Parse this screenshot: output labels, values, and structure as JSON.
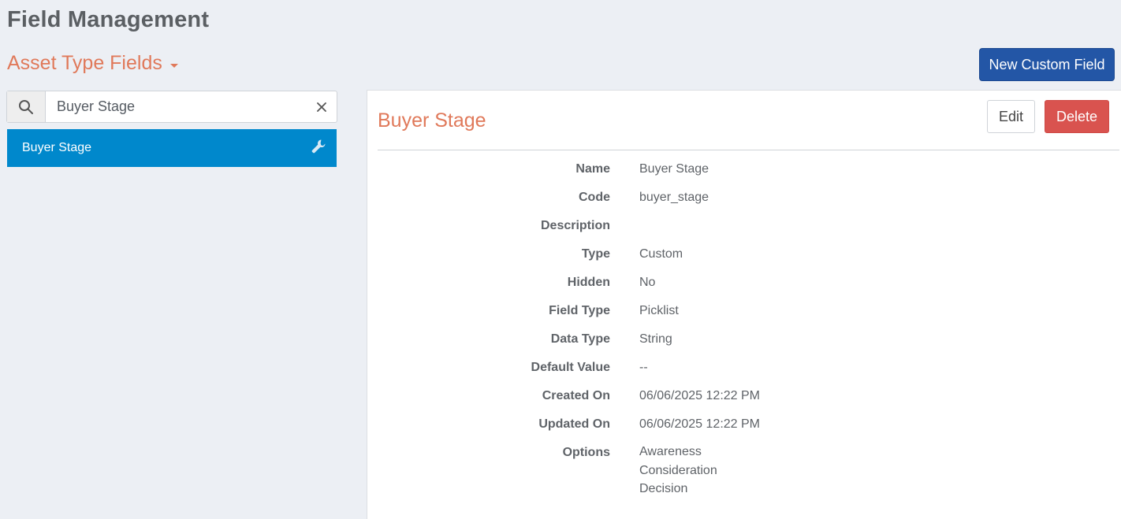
{
  "header": {
    "title": "Field Management",
    "section_dropdown": "Asset Type Fields",
    "new_button": "New Custom Field"
  },
  "search": {
    "value": "Buyer Stage",
    "placeholder": "",
    "icon": "search-icon",
    "clear_icon": "close-icon"
  },
  "list": {
    "items": [
      {
        "label": "Buyer Stage",
        "icon": "wrench-icon",
        "selected": true
      }
    ]
  },
  "detail": {
    "title": "Buyer Stage",
    "edit_label": "Edit",
    "delete_label": "Delete",
    "fields": {
      "name": {
        "label": "Name",
        "value": "Buyer Stage"
      },
      "code": {
        "label": "Code",
        "value": "buyer_stage"
      },
      "description": {
        "label": "Description",
        "value": ""
      },
      "type": {
        "label": "Type",
        "value": "Custom"
      },
      "hidden": {
        "label": "Hidden",
        "value": "No"
      },
      "field_type": {
        "label": "Field Type",
        "value": "Picklist"
      },
      "data_type": {
        "label": "Data Type",
        "value": "String"
      },
      "default_value": {
        "label": "Default Value",
        "value": "--"
      },
      "created_on": {
        "label": "Created On",
        "value": "06/06/2025 12:22 PM"
      },
      "updated_on": {
        "label": "Updated On",
        "value": "06/06/2025 12:22 PM"
      },
      "options": {
        "label": "Options",
        "values": [
          "Awareness",
          "Consideration",
          "Decision"
        ]
      }
    }
  },
  "colors": {
    "accent": "#e0795a",
    "primary_button": "#2356a6",
    "selected_item": "#0088cc",
    "danger": "#d9534f",
    "background": "#eceff4"
  }
}
